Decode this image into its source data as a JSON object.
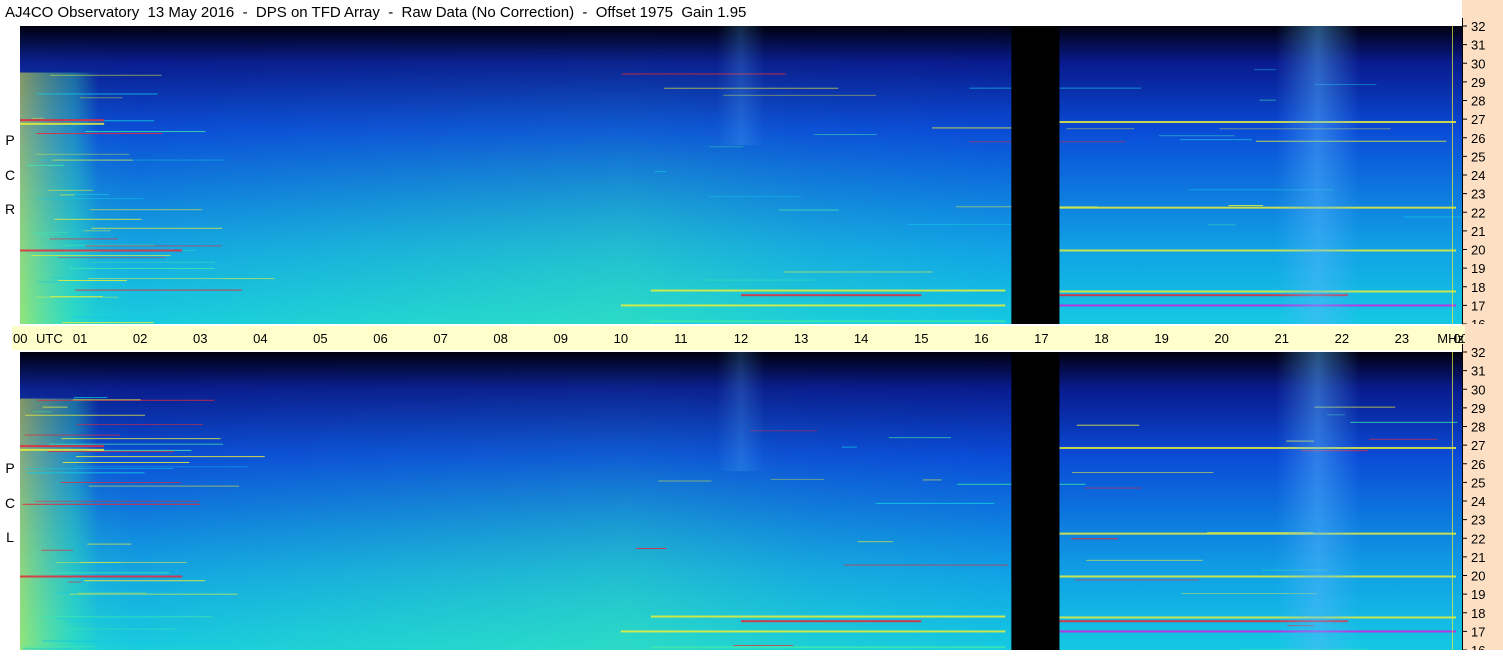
{
  "title": "AJ4CO Observatory  13 May 2016  -  DPS on TFD Array  -  Raw Data (No Correction)  -  Offset 1975  Gain 1.95",
  "panels": [
    {
      "label_letters": [
        "R",
        "C",
        "P"
      ]
    },
    {
      "label_letters": [
        "L",
        "C",
        "P"
      ]
    }
  ],
  "time_axis": {
    "labels": [
      "00",
      "01",
      "02",
      "03",
      "04",
      "05",
      "06",
      "07",
      "08",
      "09",
      "10",
      "11",
      "12",
      "13",
      "14",
      "15",
      "16",
      "17",
      "18",
      "19",
      "20",
      "21",
      "22",
      "23",
      "00"
    ],
    "unit_label": "UTC",
    "end_unit_label": "MHz"
  },
  "freq_axis": {
    "labels": [
      "32",
      "31",
      "30",
      "29",
      "28",
      "27",
      "26",
      "25",
      "24",
      "23",
      "22",
      "21",
      "20",
      "19",
      "18",
      "17",
      "16"
    ]
  },
  "colors": {
    "background_dark": "#000010",
    "deep_blue": "#0a1a8c",
    "blue": "#0a4ad8",
    "cyan": "#12c8e6",
    "green_cyan": "#3ce8b0",
    "yellow": "#e8ee3a",
    "red": "#e82838",
    "magenta": "#d020e0",
    "strip": "#ffffcc",
    "axis_bg": "#fde0c4"
  },
  "chart_data": [
    {
      "type": "heatmap",
      "title": "AJ4CO Observatory  13 May 2016  -  DPS on TFD Array  -  Raw Data (No Correction)  -  Offset 1975  Gain 1.95",
      "panel": "R C P",
      "x_range_utc_hours": [
        0,
        24
      ],
      "y_range_mhz": [
        16,
        32
      ],
      "data_gap_utc_hours": [
        16.5,
        17.3
      ],
      "grid": false
    },
    {
      "type": "heatmap",
      "panel": "L C P",
      "x_range_utc_hours": [
        0,
        24
      ],
      "y_range_mhz": [
        16,
        32
      ],
      "data_gap_utc_hours": [
        16.5,
        17.3
      ],
      "grid": false
    }
  ]
}
